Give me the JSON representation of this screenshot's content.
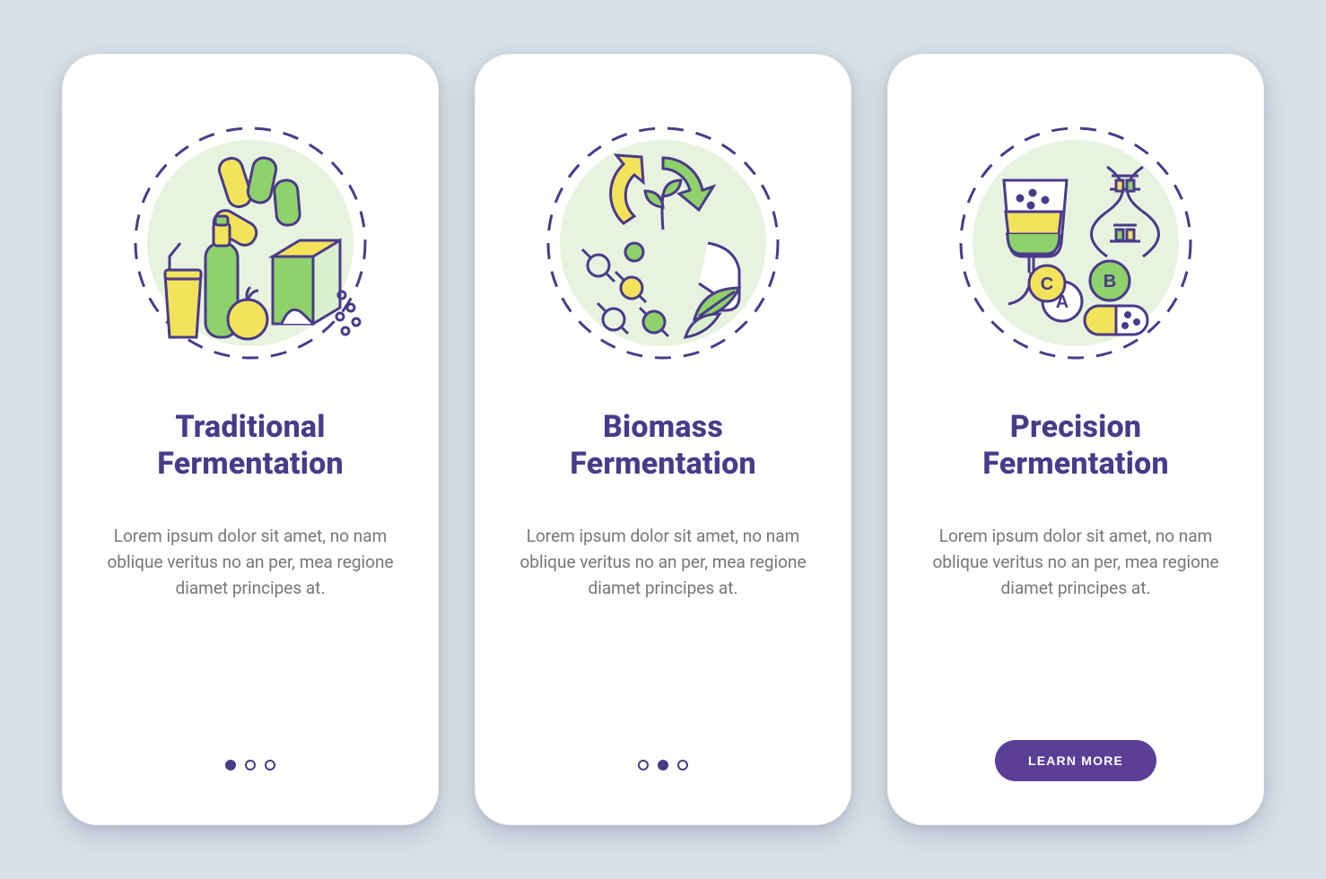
{
  "colors": {
    "stroke": "#4a3a8a",
    "green": "#8fd16a",
    "yellow": "#f3e35b",
    "greenSoft": "#d9f0cc",
    "bgCircle": "#e8f3df"
  },
  "screens": [
    {
      "title": "Traditional Fermentation",
      "body": "Lorem ipsum dolor sit amet, no nam oblique veritus no an per, mea regione diamet principes at.",
      "nav": {
        "type": "dots",
        "active": 0,
        "count": 3
      }
    },
    {
      "title": "Biomass Fermentation",
      "body": "Lorem ipsum dolor sit amet, no nam oblique veritus no an per, mea regione diamet principes at.",
      "nav": {
        "type": "dots",
        "active": 1,
        "count": 3
      }
    },
    {
      "title": "Precision Fermentation",
      "body": "Lorem ipsum dolor sit amet, no nam oblique veritus no an per, mea regione diamet principes at.",
      "nav": {
        "type": "button",
        "label": "LEARN MORE"
      }
    }
  ]
}
